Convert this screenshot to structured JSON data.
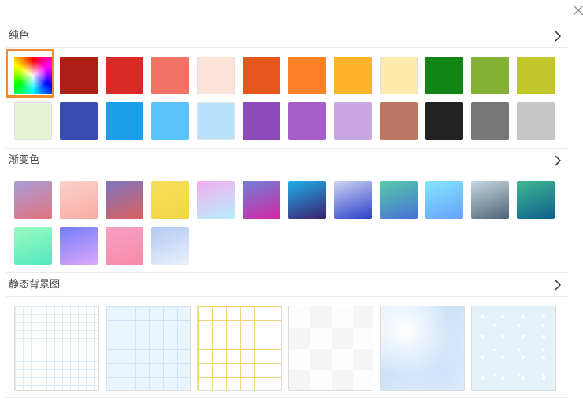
{
  "sections": {
    "solid": {
      "title": "纯色"
    },
    "gradient": {
      "title": "渐变色"
    },
    "static_bg": {
      "title": "静态背景图"
    }
  },
  "icons": {
    "close": "close-icon",
    "arrow": "chevron-right-icon"
  },
  "colors": {
    "selection": "#f08a2e",
    "solid": [
      "spectrum",
      "#ac1f15",
      "#da2a26",
      "#f07366",
      "#fde4d9",
      "#e4561c",
      "#fd8227",
      "#fdb42b",
      "#feeaaa",
      "#118617",
      "#82b136",
      "#c3c62a",
      "#e6f3d4",
      "#3a4cae",
      "#1c9fe9",
      "#5bc3fa",
      "#b7e1fb",
      "#8c4abb",
      "#a65fca",
      "#caa6e2",
      "#bb7764",
      "#222222",
      "#777777",
      "#c6c6c6"
    ],
    "gradient": [
      [
        "#a89ed8",
        "#e2727d"
      ],
      [
        "#fcd2ca",
        "#f8aba4"
      ],
      [
        "#7d76c0",
        "#db5f5d"
      ],
      [
        "#f7df5a",
        "#f1d645"
      ],
      [
        "#f3adf0",
        "#b7eefb"
      ],
      [
        "#6f80d8",
        "#d526a4"
      ],
      [
        "#21aee8",
        "#3b1f6f"
      ],
      [
        "#cfd3f4",
        "#2941c9"
      ],
      [
        "#55cba6",
        "#4870d9"
      ],
      [
        "#84e6fd",
        "#66a1fc"
      ],
      [
        "#c7d7e2",
        "#4d6477"
      ],
      [
        "#3fb88f",
        "#0e5f8e"
      ],
      [
        "#9cfbbf",
        "#53e8bf"
      ],
      [
        "#6f7ef9",
        "#dea7fb"
      ],
      [
        "#f6a0c6",
        "#f98aa8"
      ],
      [
        "#b0c9f1",
        "#eaf0fd"
      ]
    ]
  },
  "backgrounds": [
    "fine-grid-pattern",
    "blue-grid-pattern",
    "yellow-grid-pattern",
    "light-checker-pattern",
    "soft-blue-wave-pattern",
    "snow-dots-pattern"
  ]
}
